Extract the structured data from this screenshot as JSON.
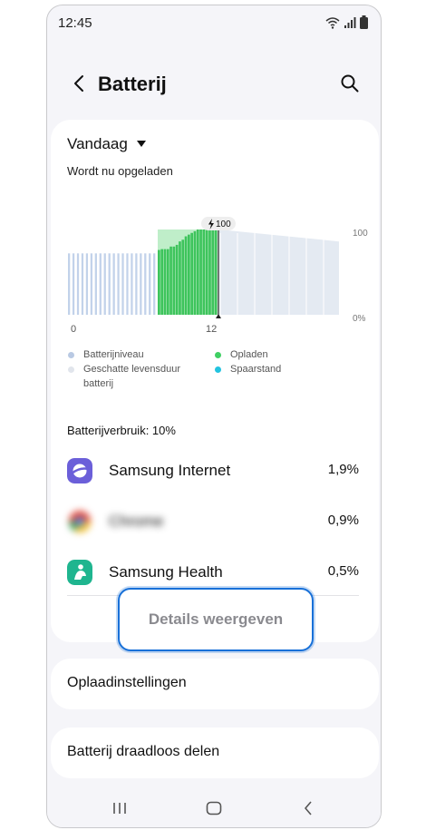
{
  "status_bar": {
    "time": "12:45",
    "icons": [
      "wifi-icon",
      "signal-icon",
      "battery-icon"
    ]
  },
  "header": {
    "title": "Batterij",
    "back_icon": "chevron-left-icon",
    "search_icon": "search-icon"
  },
  "period": {
    "label": "Vandaag",
    "dropdown_icon": "caret-down-icon"
  },
  "charging_status": "Wordt nu opgeladen",
  "chart_data": {
    "type": "bar",
    "badge": "100",
    "x_ticks": [
      "0",
      "12"
    ],
    "y_ticks": [
      "100",
      "0%"
    ],
    "ylim": [
      0,
      100
    ],
    "levels": [
      72,
      72,
      72,
      72,
      72,
      72,
      72,
      72,
      72,
      72,
      72,
      72,
      72,
      72,
      72,
      72,
      72,
      72,
      72,
      72,
      72,
      72,
      72,
      72,
      72,
      72,
      72,
      72,
      72,
      72,
      72,
      72,
      72,
      72,
      72,
      72,
      72,
      72,
      72,
      72
    ],
    "charging_levels": [
      76,
      77,
      77,
      77,
      80,
      80,
      82,
      86,
      88,
      92,
      94,
      96,
      98,
      100,
      100,
      100,
      100,
      100,
      100,
      100
    ],
    "estimated_levels": [
      100,
      98,
      96,
      94,
      92,
      90,
      88,
      86
    ],
    "legend": [
      {
        "label": "Batterijniveau",
        "color": "#b9c9e3"
      },
      {
        "label": "Geschatte levensduur batterij",
        "color": "#e1e5ec"
      },
      {
        "label": "Opladen",
        "color": "#3fcf63"
      },
      {
        "label": "Spaarstand",
        "color": "#22c3df"
      }
    ],
    "colors": {
      "level": "#c2d2ea",
      "charging": "#3ec45c",
      "charging_light": "#bfeec9",
      "estimate": "#e4eaf2"
    }
  },
  "usage": {
    "label": "Batterijverbruik: 10%",
    "apps": [
      {
        "name": "Samsung Internet",
        "percent": "1,9%",
        "icon": "samsung-internet-icon",
        "color": "#6b5fd9"
      },
      {
        "name": "Chrome",
        "percent": "0,9%",
        "icon": "chrome-icon",
        "color": "#e9a23b"
      },
      {
        "name": "Samsung Health",
        "percent": "0,5%",
        "icon": "samsung-health-icon",
        "color": "#1fb58f"
      }
    ]
  },
  "details_button": "Details weergeven",
  "settings": {
    "charging": "Oplaadinstellingen",
    "wireless_share": "Batterij draadloos delen"
  },
  "navbar": {
    "recent_icon": "recent-apps-icon",
    "home_icon": "home-icon",
    "back_icon": "back-icon"
  }
}
